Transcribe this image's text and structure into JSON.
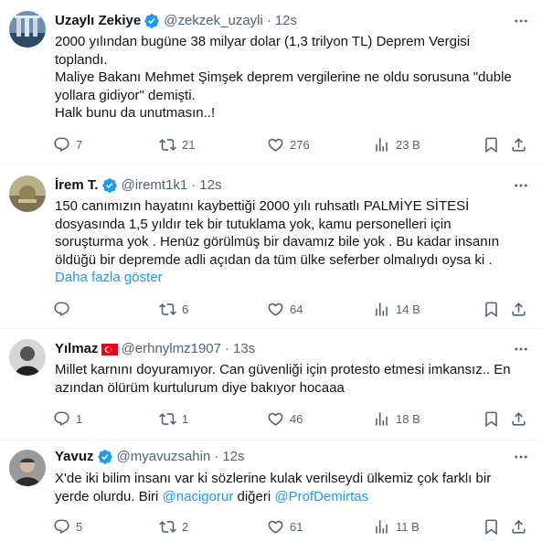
{
  "tweets": [
    {
      "name": "Uzaylı Zekiye",
      "handle": "@zekzek_uzayli",
      "time": "12s",
      "lines": [
        "2000 yılından bugüne 38 milyar dolar (1,3 trilyon TL) Deprem Vergisi",
        "toplandı.",
        "Maliye Bakanı Mehmet Şimşek deprem vergilerine ne oldu sorusuna \"duble",
        "yollara gidiyor\" demişti.",
        "Halk bunu da unutmasın..!"
      ],
      "reply_count": "7",
      "retweet_count": "21",
      "like_count": "276",
      "view_count": "23 B"
    },
    {
      "name": "İrem T.",
      "handle": "@iremt1k1",
      "time": "12s",
      "lines": [
        "150 canımızın hayatını kaybettiği 2000 yılı ruhsatlı PALMİYE SİTESİ",
        "dosyasında 1,5 yıldır tek bir tutuklama yok, kamu personelleri için",
        "soruşturma yok . Henüz görülmüş bir davamız bile yok . Bu kadar insanın",
        "öldüğü bir depremde adli açıdan da tüm ülke seferber olmalıydı oysa ki ."
      ],
      "show_more": "Daha fazla göster",
      "reply_count": "",
      "retweet_count": "6",
      "like_count": "64",
      "view_count": "14 B"
    },
    {
      "name": "Yılmaz",
      "handle": "@erhnylmz1907",
      "time": "13s",
      "lines": [
        "Millet karnını doyuramıyor. Can güvenliği için protesto etmesi imkansız.. En",
        "azından ölürüm kurtulurum diye bakıyor hocaaa"
      ],
      "reply_count": "1",
      "retweet_count": "1",
      "like_count": "46",
      "view_count": "18 B"
    },
    {
      "name": "Yavuz",
      "handle": "@myavuzsahin",
      "time": "12s",
      "line1": "X'de iki bilim insanı var ki sözlerine kulak verilseydi ülkemiz çok farklı bir",
      "line2_before": "yerde olurdu. Biri ",
      "mention1": "@nacigorur",
      "line2_middle": " diğeri ",
      "mention2": "@ProfDemirtas",
      "reply_count": "5",
      "retweet_count": "2",
      "like_count": "61",
      "view_count": "11 B"
    }
  ],
  "colors": {
    "text": "#0f1419",
    "secondary": "#536471",
    "link": "#1d9bf0",
    "verified": "#1d9bf0",
    "divider": "#eff3f4"
  },
  "icons": [
    "reply-icon",
    "retweet-icon",
    "like-icon",
    "views-icon",
    "bookmark-icon",
    "share-icon",
    "more-icon",
    "verified-icon",
    "turkish-flag-icon"
  ]
}
